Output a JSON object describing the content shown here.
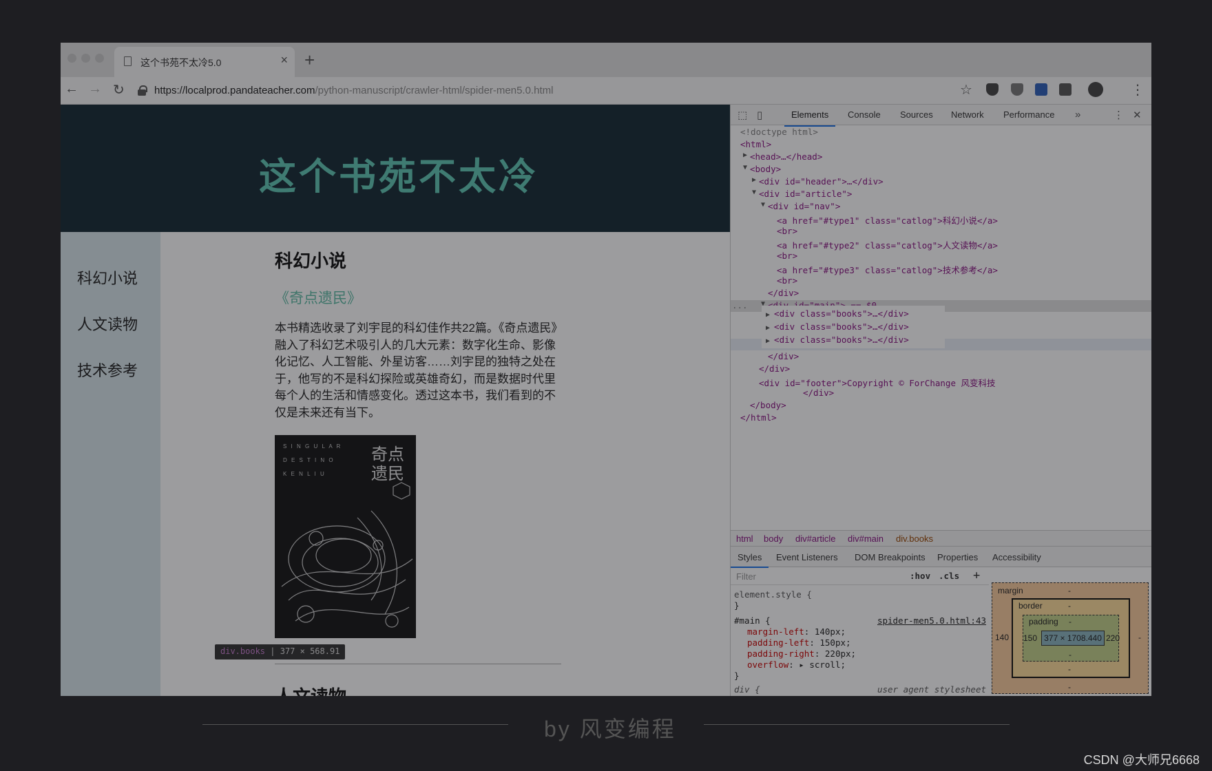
{
  "browser": {
    "tab_title": "这个书苑不太冷5.0",
    "tab_close": "×",
    "new_tab": "+",
    "url_host": "https://localprod.pandateacher.com",
    "url_path": "/python-manuscript/crawler-html/spider-men5.0.html",
    "back": "←",
    "forward": "→",
    "reload": "↻",
    "star": "☆",
    "menu": "⋮"
  },
  "page": {
    "header_title": "这个书苑不太冷",
    "nav": [
      "科幻小说",
      "人文读物",
      "技术参考"
    ],
    "section_title": "科幻小说",
    "book_title": "《奇点遗民》",
    "book_desc": "本书精选收录了刘宇昆的科幻佳作共22篇。《奇点遗民》融入了科幻艺术吸引人的几大元素：数字化生命、影像化记忆、人工智能、外星访客……刘宇昆的独特之处在于，他写的不是科幻探险或英雄奇幻，而是数据时代里每个人的生活和情感变化。透过这本书，我们看到的不仅是未来还有当下。",
    "cover_title_1": "奇点",
    "cover_title_2": "遗民",
    "cover_letters_1": "S I N G U L A R",
    "cover_letters_2": "D E S T I N O",
    "cover_letters_3": "K E N   L I U",
    "next_section_title": "人文读物",
    "tooltip_tag": "div.books",
    "tooltip_size": "377 × 568.91"
  },
  "devtools": {
    "tabs": [
      "Elements",
      "Console",
      "Sources",
      "Network",
      "Performance"
    ],
    "more": "»",
    "close": "✕",
    "kebab": "⋮",
    "dom": {
      "doctype": "<!doctype html>",
      "html_open": "<html>",
      "head": "<head>…</head>",
      "body_open": "<body>",
      "header_div": "<div id=\"header\">…</div>",
      "article_div": "<div id=\"article\">",
      "nav_div": "<div id=\"nav\">",
      "link1": "<a href=\"#type1\" class=\"catlog\">科幻小说</a>",
      "link2": "<a href=\"#type2\" class=\"catlog\">人文读物</a>",
      "link3": "<a href=\"#type3\" class=\"catlog\">技术参考</a>",
      "br": "<br>",
      "div_close": "</div>",
      "main_div": "<div id=\"main\"> == $0",
      "books_div": "<div class=\"books\">…</div>",
      "footer_open": "<div id=\"footer\">Copyright © ForChange 风变科技",
      "footer_close": "</div>",
      "body_close": "</body>",
      "html_close": "</html>",
      "ellipsis": "..."
    },
    "breadcrumbs": [
      "html",
      "body",
      "div#article",
      "div#main",
      "div.books"
    ],
    "subtabs": [
      "Styles",
      "Event Listeners",
      "DOM Breakpoints",
      "Properties",
      "Accessibility"
    ],
    "filter_placeholder": "Filter",
    "hov": ":hov",
    "cls": ".cls",
    "add": "+",
    "styles": {
      "element_style": "element.style {",
      "brace_close": "}",
      "main_rule": "#main {",
      "source": "spider-men5.0.html:43",
      "decl1_prop": "margin-left",
      "decl1_val": "140px;",
      "decl2_prop": "padding-left",
      "decl2_val": "150px;",
      "decl3_prop": "padding-right",
      "decl3_val": "220px;",
      "decl4_prop": "overflow",
      "decl4_val": "▸ scroll;",
      "div_rule": "div {",
      "ua_source": "user agent stylesheet"
    },
    "box_model": {
      "margin": "margin",
      "border": "border",
      "padding": "padding",
      "dash": "-",
      "margin_left": "140",
      "padding_left": "150",
      "padding_right": "220",
      "content": "377 × 1708.440"
    }
  },
  "footer": {
    "text": "by 风变编程",
    "watermark": "CSDN @大师兄6668"
  }
}
